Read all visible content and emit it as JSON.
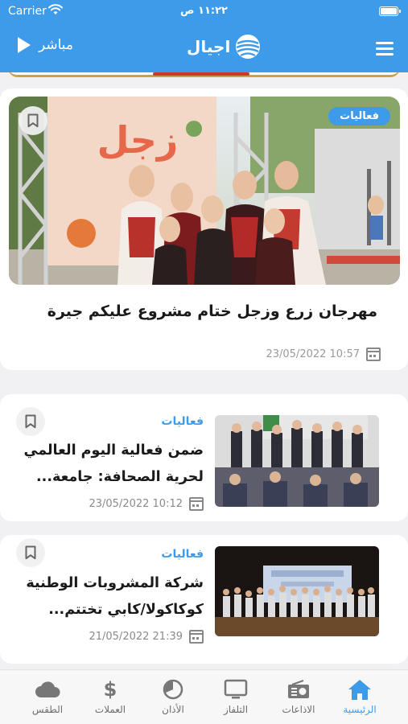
{
  "status_bar": {
    "carrier": "Carrier",
    "time": "١١:٢٢ ص"
  },
  "header": {
    "live_label": "مباشر",
    "logo_text": "اجيال"
  },
  "hero": {
    "category": "فعاليات",
    "title": "مهرجان زرع وزجل ختام مشروع عليكم جيرة",
    "date": "23/05/2022 10:57"
  },
  "articles": [
    {
      "category": "فعاليات",
      "title": "ضمن فعالية اليوم العالمي لحرية الصحافة: جامعة...",
      "date": "23/05/2022 10:12"
    },
    {
      "category": "فعاليات",
      "title": "شركة المشروبات الوطنية كوكاكولا/كابي تختتم...",
      "date": "21/05/2022 21:39"
    }
  ],
  "tabs": [
    {
      "label": "الرئيسية",
      "icon": "home-icon"
    },
    {
      "label": "الاذاعات",
      "icon": "radio-icon"
    },
    {
      "label": "التلفاز",
      "icon": "tv-icon"
    },
    {
      "label": "الأذان",
      "icon": "prayer-clock-icon"
    },
    {
      "label": "العملات",
      "icon": "dollar-icon"
    },
    {
      "label": "الطقس",
      "icon": "cloud-icon"
    }
  ],
  "colors": {
    "brand": "#3d9be9",
    "text": "#1a1a1a",
    "muted": "#8a8a8a",
    "background": "#f1f1f3"
  }
}
